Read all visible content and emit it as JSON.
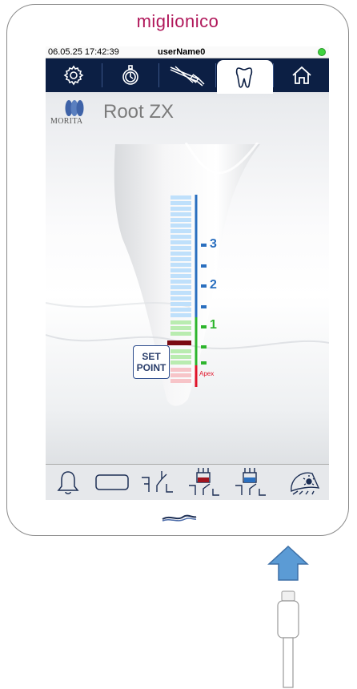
{
  "brand": "miglionico",
  "status": {
    "datetime": "06.05.25 17:42:39",
    "user": "userName0",
    "led_color": "#3fd43f"
  },
  "tabs": [
    {
      "icon": "gear-icon",
      "active": false
    },
    {
      "icon": "stopwatch-icon",
      "active": false
    },
    {
      "icon": "instruments-icon",
      "active": false
    },
    {
      "icon": "tooth-icon",
      "active": true
    },
    {
      "icon": "home-icon",
      "active": false
    }
  ],
  "header": {
    "logo_text": "MORITA",
    "title": "Root ZX"
  },
  "scale": {
    "labels": [
      "3",
      "2",
      "1"
    ],
    "apex_label": "Apex",
    "colors": {
      "blue": "#2a6fbf",
      "green": "#2db52d",
      "red": "#e0142a",
      "dark_red": "#7a0a12"
    }
  },
  "setpoint": {
    "line1": "SET",
    "line2": "POINT"
  },
  "toolbar": [
    {
      "icon": "bell-icon"
    },
    {
      "icon": "rectangle-icon"
    },
    {
      "icon": "motor-stop-icon"
    },
    {
      "icon": "motor-reverse-red-icon"
    },
    {
      "icon": "motor-reverse-blue-icon"
    },
    {
      "icon": "light-icon"
    }
  ]
}
